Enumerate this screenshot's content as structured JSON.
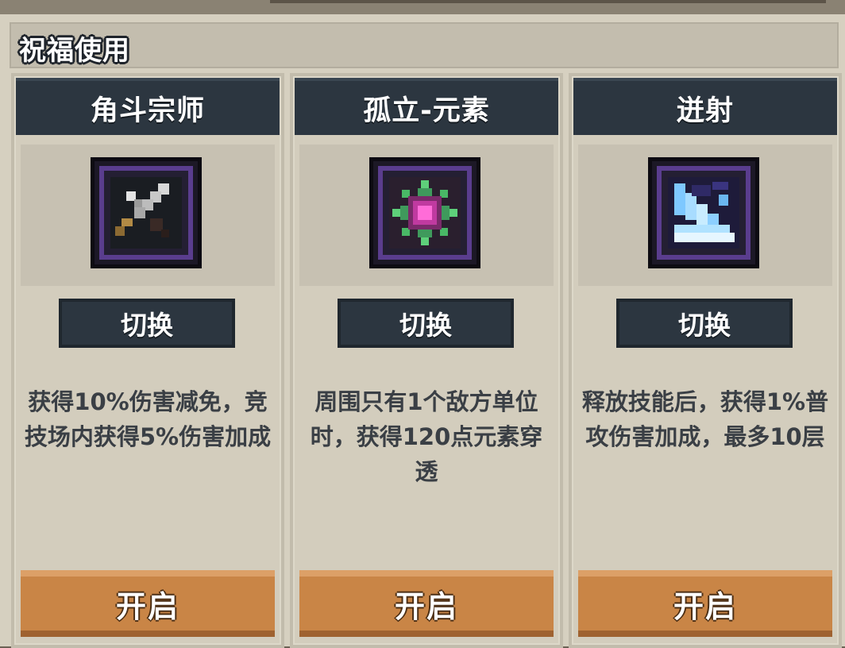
{
  "section": {
    "title": "祝福使用"
  },
  "cards": [
    {
      "title": "角斗宗师",
      "icon": "sword-icon",
      "switch_label": "切换",
      "description": "获得10%伤害减免，竞技场内获得5%伤害加成",
      "open_label": "开启"
    },
    {
      "title": "孤立-元素",
      "icon": "element-orb-icon",
      "switch_label": "切换",
      "description": "周围只有1个敌方单位时，获得120点元素穿透",
      "open_label": "开启"
    },
    {
      "title": "迸射",
      "icon": "ice-burst-icon",
      "switch_label": "切换",
      "description": "释放技能后，获得1%普攻伤害加成，最多10层",
      "open_label": "开启"
    }
  ],
  "colors": {
    "panel": "#d6d0c0",
    "card_header": "#2c3640",
    "open_button": "#c98546",
    "icon_border": "#5a3d8e"
  }
}
